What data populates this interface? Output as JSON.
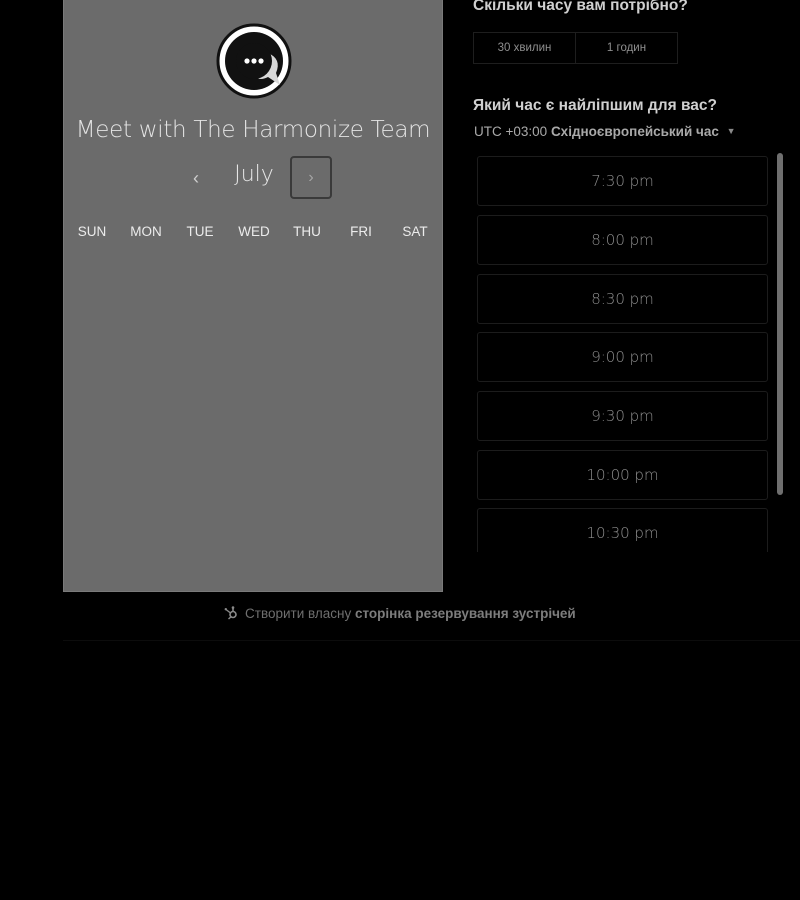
{
  "calendar": {
    "title": "Meet with The Harmonize Team",
    "month": "July",
    "prev_icon": "chevron-left-icon",
    "next_icon": "chevron-right-icon",
    "weekdays": [
      "SUN",
      "MON",
      "TUE",
      "WED",
      "THU",
      "FRI",
      "SAT"
    ],
    "avatar_icon": "chat-bubble-icon"
  },
  "duration": {
    "question": "Скільки часу вам потрібно?",
    "options": [
      "30 хвилин",
      "1 годин"
    ]
  },
  "time": {
    "question": "Який час є найліпшим для вас?",
    "timezone_offset": "UTC +03:00",
    "timezone_name": "Східноєвропейський час",
    "slots": [
      "7:30 pm",
      "8:00 pm",
      "8:30 pm",
      "9:00 pm",
      "9:30 pm",
      "10:00 pm",
      "10:30 pm"
    ]
  },
  "footer": {
    "prefix": "Створити власну",
    "link": "сторінка резервування зустрічей",
    "icon": "hubspot-sprocket-icon"
  }
}
